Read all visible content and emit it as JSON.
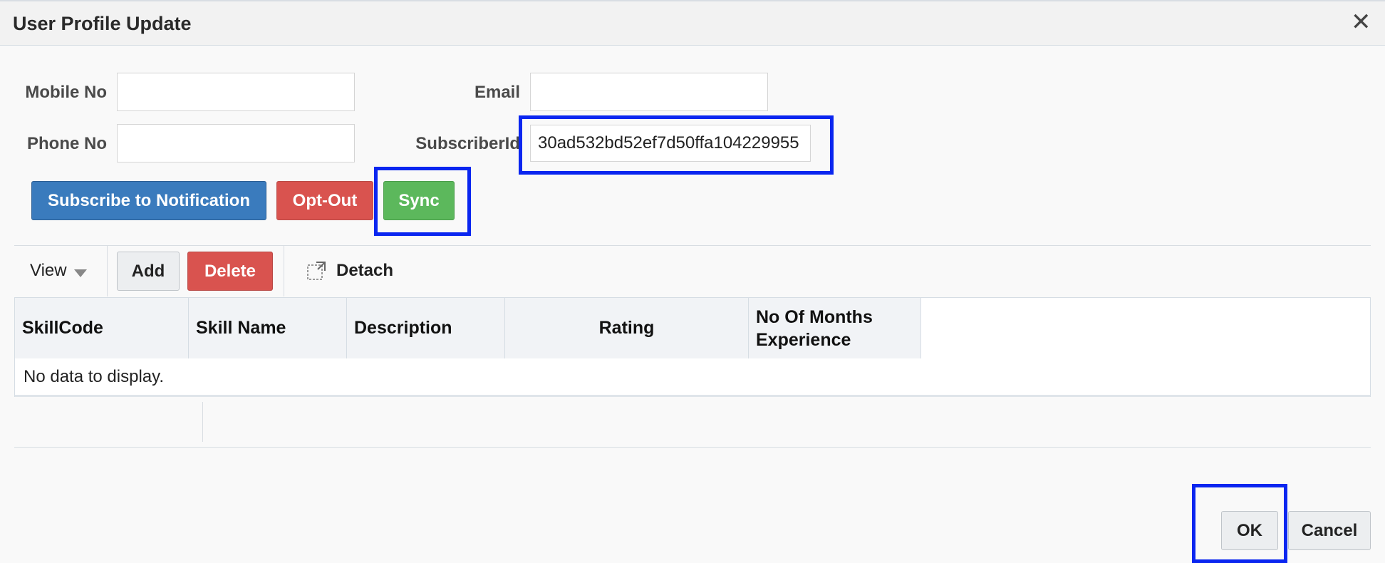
{
  "dialog": {
    "title": "User Profile Update"
  },
  "form": {
    "mobile_label": "Mobile No",
    "mobile_value": "",
    "phone_label": "Phone No",
    "phone_value": "",
    "email_label": "Email",
    "email_value": "",
    "subscriber_label": "SubscriberId",
    "subscriber_value": "30ad532bd52ef7d50ffa104229955"
  },
  "actions": {
    "subscribe": "Subscribe to Notification",
    "optout": "Opt-Out",
    "sync": "Sync"
  },
  "toolbar": {
    "view": "View",
    "add": "Add",
    "delete": "Delete",
    "detach": "Detach"
  },
  "table": {
    "columns": [
      "SkillCode",
      "Skill Name",
      "Description",
      "Rating",
      "No Of Months Experience"
    ],
    "empty_text": "No data to display."
  },
  "footer": {
    "ok": "OK",
    "cancel": "Cancel"
  },
  "colors": {
    "primary": "#3a7bbd",
    "danger": "#d9534f",
    "success": "#5cb85c",
    "highlight": "#0a26f0"
  }
}
